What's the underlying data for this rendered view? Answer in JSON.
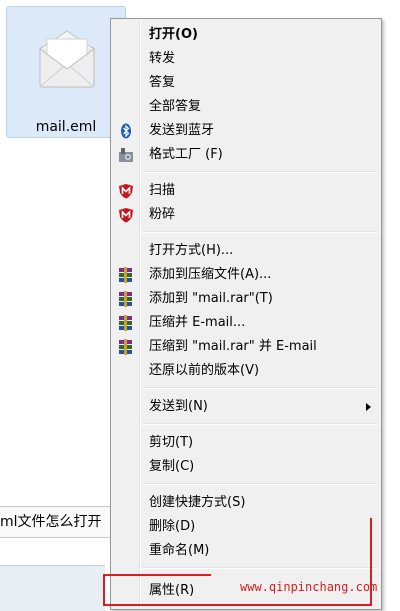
{
  "file": {
    "name": "mail.eml",
    "icon": "envelope-icon"
  },
  "background_text": "ml文件怎么打开",
  "watermark": "www.qinpinchang.com",
  "menu": {
    "items": [
      {
        "label": "打开(O)",
        "bold": true
      },
      {
        "label": "转发"
      },
      {
        "label": "答复"
      },
      {
        "label": "全部答复"
      },
      {
        "label": "发送到蓝牙",
        "icon": "bluetooth-icon"
      },
      {
        "label": "格式工厂 (F)",
        "icon": "format-factory-icon"
      },
      {
        "label": "扫描",
        "icon": "mcafee-shield-icon"
      },
      {
        "label": "粉碎",
        "icon": "mcafee-shield-icon"
      },
      {
        "label": "打开方式(H)..."
      },
      {
        "label": "添加到压缩文件(A)...",
        "icon": "winrar-icon"
      },
      {
        "label": "添加到 \"mail.rar\"(T)",
        "icon": "winrar-icon"
      },
      {
        "label": "压缩并 E-mail...",
        "icon": "winrar-icon"
      },
      {
        "label": "压缩到 \"mail.rar\" 并 E-mail",
        "icon": "winrar-icon"
      },
      {
        "label": "还原以前的版本(V)"
      },
      {
        "label": "发送到(N)",
        "submenu": true
      },
      {
        "label": "剪切(T)"
      },
      {
        "label": "复制(C)"
      },
      {
        "label": "创建快捷方式(S)"
      },
      {
        "label": "删除(D)"
      },
      {
        "label": "重命名(M)"
      },
      {
        "label": "属性(R)"
      }
    ]
  },
  "colors": {
    "menu_bg": "#f0f0f0",
    "selection_bg": "#dbe9f8",
    "highlight_red": "#d42020"
  }
}
